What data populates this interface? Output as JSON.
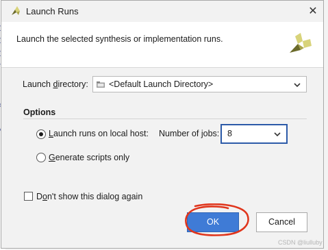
{
  "window": {
    "title": "Launch Runs",
    "close_glyph": "✕"
  },
  "header": {
    "description": "Launch the selected synthesis or implementation runs."
  },
  "launch_directory": {
    "label_before": "Launch ",
    "label_mnemonic": "d",
    "label_after": "irectory:",
    "value": "<Default Launch Directory>",
    "icon": "folder-icon"
  },
  "options": {
    "title": "Options",
    "local_host": {
      "mnemonic": "L",
      "label_rest": "aunch runs on local host:",
      "selected": true
    },
    "jobs": {
      "label_before": "Number of ",
      "label_mnemonic": "j",
      "label_after": "obs:",
      "value": "8"
    },
    "scripts_only": {
      "mnemonic": "G",
      "label_rest": "enerate scripts only",
      "selected": false
    }
  },
  "dont_show": {
    "label_before": "D",
    "label_mnemonic": "o",
    "label_after": "n't show this dialog again",
    "checked": false
  },
  "buttons": {
    "ok": "OK",
    "cancel": "Cancel"
  },
  "background_letters": [
    "p",
    "p",
    "p",
    "t",
    "s",
    "d"
  ],
  "watermark": "CSDN @liulluby",
  "colors": {
    "accent": "#3f7bd6",
    "focus_border": "#2b5aa8",
    "annotation": "#e0351c",
    "logo_light": "#d8d37a",
    "logo_dark": "#6b6a2a"
  }
}
